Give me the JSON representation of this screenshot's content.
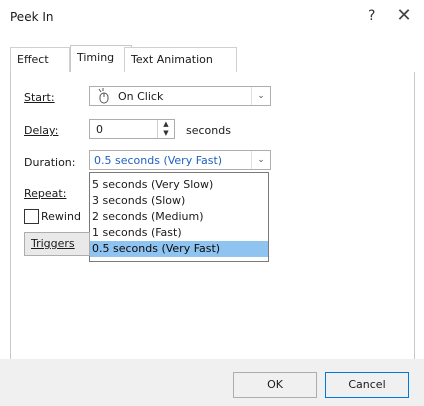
{
  "window": {
    "title": "Peek In",
    "help_glyph": "?",
    "close_glyph": "✕"
  },
  "tabs": [
    {
      "label": "Effect"
    },
    {
      "label": "Timing"
    },
    {
      "label": "Text Animation"
    }
  ],
  "timing": {
    "start_label": "Start:",
    "start_value": "On Click",
    "delay_label": "Delay:",
    "delay_value": "0",
    "delay_unit": "seconds",
    "duration_label": "Duration:",
    "duration_value": "0.5 seconds (Very Fast)",
    "repeat_label": "Repeat:",
    "rewind_label": "Rewind",
    "triggers_label": "Triggers"
  },
  "duration_options": [
    "5 seconds (Very Slow)",
    "3 seconds (Slow)",
    "2 seconds (Medium)",
    "1 seconds (Fast)",
    "0.5 seconds (Very Fast)"
  ],
  "footer": {
    "ok_label": "OK",
    "cancel_label": "Cancel"
  },
  "colors": {
    "selection": "#8fc3f0",
    "accent": "#0078d7",
    "footer_bg": "#f0f0f0"
  }
}
